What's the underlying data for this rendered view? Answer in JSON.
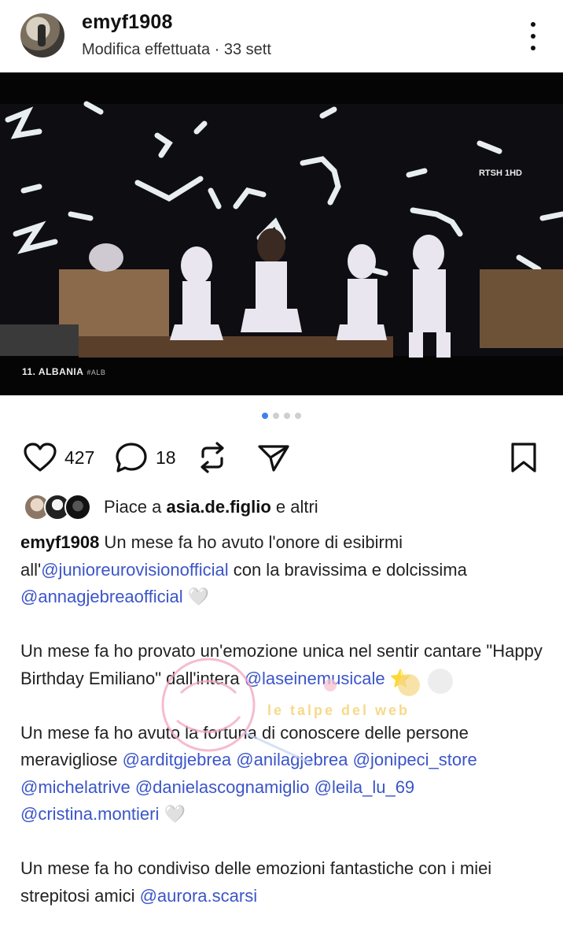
{
  "post": {
    "username": "emyf1908",
    "subtitle": "Modifica effettuata · 33 sett"
  },
  "media": {
    "channel_logo": "RTSH 1HD",
    "caption_bar": "11. ALBANIA",
    "caption_tag": "#ALB",
    "carousel": {
      "total": 4,
      "active_index": 0
    }
  },
  "icons": {
    "more": "more-vertical-icon",
    "like": "heart-outline-icon",
    "comment": "comment-bubble-icon",
    "repost": "repost-icon",
    "share": "send-icon",
    "save": "bookmark-icon"
  },
  "actions": {
    "likes": "427",
    "comments": "18"
  },
  "likes_line": {
    "prefix": "Piace a ",
    "user": "asia.de.figlio",
    "suffix": " e altri"
  },
  "caption": {
    "p1_user": "emyf1908",
    "p1_a": " Un mese fa ho avuto l'onore di esibirmi all'",
    "p1_m1": "@junioreurovisionofficial",
    "p1_b": " con la bravissima e dolcissima ",
    "p1_m2": "@annagjebreaofficial",
    "p1_heart": " 🤍",
    "p2_a": "Un mese fa ho provato un'emozione unica nel sentir cantare \"Happy Birthday Emiliano\" dall'intera ",
    "p2_m1": "@laseinemusicale",
    "p2_star": " ⭐",
    "p3_a": "Un mese fa ho avuto la fortuna di conoscere delle persone meravigliose ",
    "p3_m1": "@arditgjebrea",
    "p3_m2": "@anilagjebrea",
    "p3_m3": "@jonipeci_store",
    "p3_m4": "@michelatrive",
    "p3_m5": "@danielascognamiglio",
    "p3_m6": "@leila_lu_69",
    "p3_m7": "@cristina.montieri",
    "p3_heart": " 🤍",
    "p4_a": "Un mese fa ho condiviso delle emozioni fantastiche con i miei strepitosi amici  ",
    "p4_m1": "@aurora.scarsi"
  },
  "watermark": {
    "text": "le talpe del web"
  }
}
